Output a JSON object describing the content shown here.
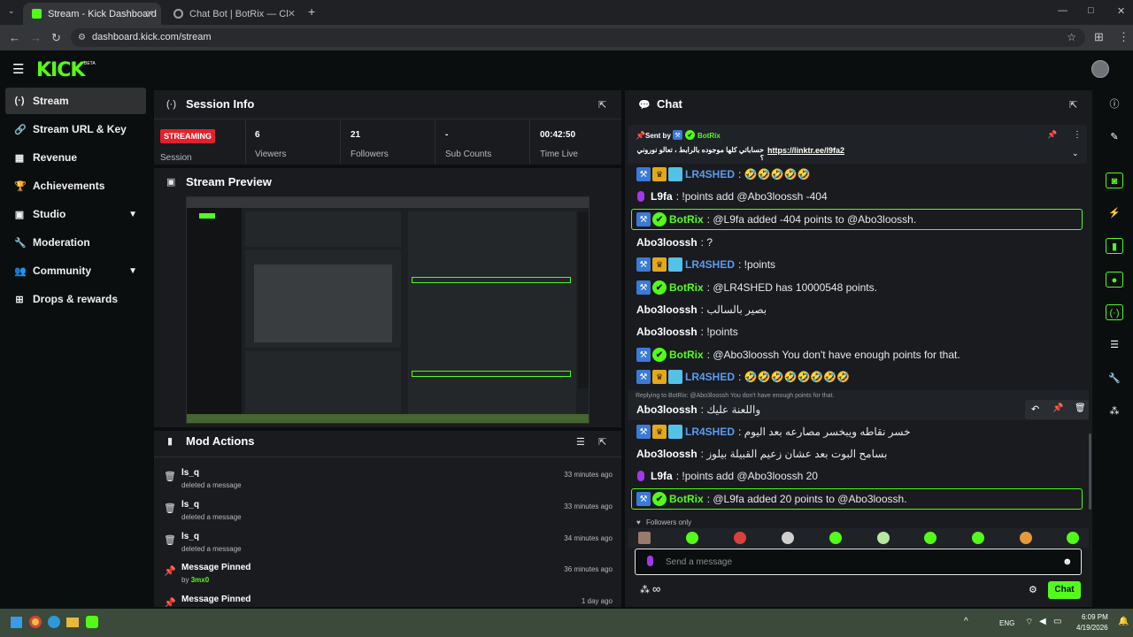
{
  "browser": {
    "tabs": [
      {
        "title": "Stream - Kick Dashboard",
        "close": "✕"
      },
      {
        "title": "Chat Bot | BotRix — Cloud Stre",
        "close": "✕"
      }
    ],
    "new_tab": "+",
    "url": "dashboard.kick.com/stream"
  },
  "app": {
    "logo": "KICK",
    "logo_sup": "BETA"
  },
  "sidebar": {
    "items": [
      {
        "label": "Stream",
        "icon": "(·)"
      },
      {
        "label": "Stream URL & Key",
        "icon": "🔗"
      },
      {
        "label": "Revenue",
        "icon": "▦"
      },
      {
        "label": "Achievements",
        "icon": "🏆"
      },
      {
        "label": "Studio",
        "icon": "▣"
      },
      {
        "label": "Moderation",
        "icon": "🔧"
      },
      {
        "label": "Community",
        "icon": "👥"
      },
      {
        "label": "Drops & rewards",
        "icon": "⊞"
      }
    ]
  },
  "session": {
    "title": "Session Info",
    "status_badge": "STREAMING",
    "status_label": "Session",
    "stats": [
      {
        "value": "6",
        "label": "Viewers"
      },
      {
        "value": "21",
        "label": "Followers"
      },
      {
        "value": "-",
        "label": "Sub Counts"
      },
      {
        "value": "00:42:50",
        "label": "Time Live"
      }
    ]
  },
  "preview": {
    "title": "Stream Preview"
  },
  "mod_actions": {
    "title": "Mod Actions",
    "rows": [
      {
        "title": "ls_q",
        "sub": "deleted a message",
        "time": "33 minutes ago",
        "icon": "🗑"
      },
      {
        "title": "ls_q",
        "sub": "deleted a message",
        "time": "33 minutes ago",
        "icon": "🗑"
      },
      {
        "title": "ls_q",
        "sub": "deleted a message",
        "time": "34 minutes ago",
        "icon": "🗑"
      },
      {
        "title": "Message Pinned",
        "sub_prefix": "by",
        "sub_user": "3mx0",
        "time": "36 minutes ago",
        "icon": "📌"
      },
      {
        "title": "Message Pinned",
        "sub": "",
        "time": "1 day ago",
        "icon": "📌"
      }
    ]
  },
  "chat": {
    "title": "Chat",
    "pinned": {
      "sent_by": "Sent by",
      "user": "BotRix",
      "text_rtl": "حساباتي كلها موجوده بالرابط ، تعالو نوروني ؟",
      "link": "https://linktr.ee/l9fa2"
    },
    "messages": [
      {
        "user": "LR4SHED",
        "color": "#5b9cf0",
        "text": ": 🤣🤣🤣🤣🤣"
      },
      {
        "user": "L9fa",
        "color": "#ffffff",
        "text": ": !points add @Abo3loossh -404"
      },
      {
        "user": "BotRix",
        "color": "#53fc18",
        "text": ": @L9fa added -404 points to @Abo3loossh."
      },
      {
        "user": "Abo3loossh",
        "color": "#ffffff",
        "text": ": ?"
      },
      {
        "user": "LR4SHED",
        "color": "#5b9cf0",
        "text": ": !points"
      },
      {
        "user": "BotRix",
        "color": "#53fc18",
        "text": ": @LR4SHED has 10000548 points."
      },
      {
        "user": "Abo3loossh",
        "color": "#ffffff",
        "text": ": بصير بالسالب"
      },
      {
        "user": "Abo3loossh",
        "color": "#ffffff",
        "text": ": !points"
      },
      {
        "user": "BotRix",
        "color": "#53fc18",
        "text": ": @Abo3loossh You don't have enough points for that."
      },
      {
        "user": "LR4SHED",
        "color": "#5b9cf0",
        "text": ": 🤣🤣🤣🤣🤣🤣🤣🤣"
      },
      {
        "user": "Abo3loossh",
        "color": "#ffffff",
        "text": ": واللعنة عليك"
      },
      {
        "user": "LR4SHED",
        "color": "#5b9cf0",
        "text": ": خسر نقاطه ويبخسر مصارعه بعد اليوم"
      },
      {
        "user": "Abo3loossh",
        "color": "#ffffff",
        "text": ": بسامح البوت بعد عشان زعيم القبيلة بيلوز"
      },
      {
        "user": "L9fa",
        "color": "#ffffff",
        "text": ": !points add @Abo3loossh 20"
      },
      {
        "user": "BotRix",
        "color": "#53fc18",
        "text": ": @L9fa added 20 points to @Abo3loossh."
      }
    ],
    "reply_hint": "Replying to BotRix: @Abo3loossh You don't have enough points for that.",
    "followers_only": "Followers only",
    "input_placeholder": "Send a message",
    "chat_button": "Chat",
    "infinity": "∞"
  },
  "taskbar": {
    "lang": "ENG",
    "time": "6:09 PM",
    "date": "4/19/2026"
  },
  "colors": {
    "accent": "#53fc18",
    "panel": "#191b1f",
    "bg": "#0b0e0f",
    "streaming": "#e5202a"
  }
}
